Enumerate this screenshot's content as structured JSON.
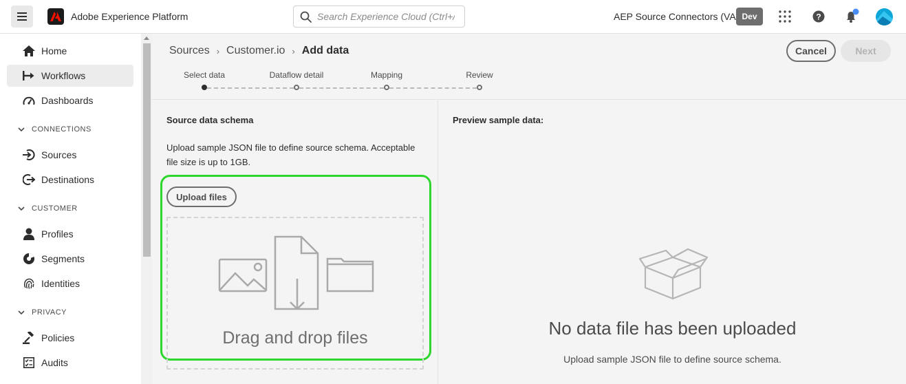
{
  "topbar": {
    "app_title": "Adobe Experience Platform",
    "search_placeholder": "Search Experience Cloud (Ctrl+/)",
    "org_name": "AEP Source Connectors (VA7)",
    "env_badge": "Dev",
    "icons": [
      "menu-icon",
      "adobe-logo",
      "search-icon",
      "apps-grid-icon",
      "help-icon",
      "notification-bell-icon",
      "user-avatar"
    ],
    "accent_color": "#0da6d8"
  },
  "sidebar": {
    "items": [
      {
        "label": "Home",
        "icon": "home-icon"
      },
      {
        "label": "Workflows",
        "icon": "workflows-icon",
        "active": true
      },
      {
        "label": "Dashboards",
        "icon": "dashboards-icon"
      }
    ],
    "sections": [
      {
        "title": "CONNECTIONS",
        "items": [
          {
            "label": "Sources",
            "icon": "sources-icon"
          },
          {
            "label": "Destinations",
            "icon": "destinations-icon"
          }
        ]
      },
      {
        "title": "CUSTOMER",
        "items": [
          {
            "label": "Profiles",
            "icon": "profiles-icon"
          },
          {
            "label": "Segments",
            "icon": "segments-icon"
          },
          {
            "label": "Identities",
            "icon": "identities-icon"
          }
        ]
      },
      {
        "title": "PRIVACY",
        "items": [
          {
            "label": "Policies",
            "icon": "policies-icon"
          },
          {
            "label": "Audits",
            "icon": "audits-icon"
          }
        ]
      }
    ]
  },
  "breadcrumb": [
    "Sources",
    "Customer.io",
    "Add data"
  ],
  "actions": {
    "cancel": "Cancel",
    "next": "Next"
  },
  "steps": [
    {
      "label": "Select data",
      "current": true
    },
    {
      "label": "Dataflow detail"
    },
    {
      "label": "Mapping"
    },
    {
      "label": "Review"
    }
  ],
  "left_panel": {
    "title": "Source data schema",
    "description": "Upload sample JSON file to define source schema. Acceptable file size is up to 1GB.",
    "upload_button": "Upload files",
    "drop_text": "Drag and drop files",
    "highlight_color": "#2dd62d"
  },
  "right_panel": {
    "title": "Preview sample data:",
    "empty_title": "No data file has been uploaded",
    "empty_desc": "Upload sample JSON file to define source schema."
  }
}
